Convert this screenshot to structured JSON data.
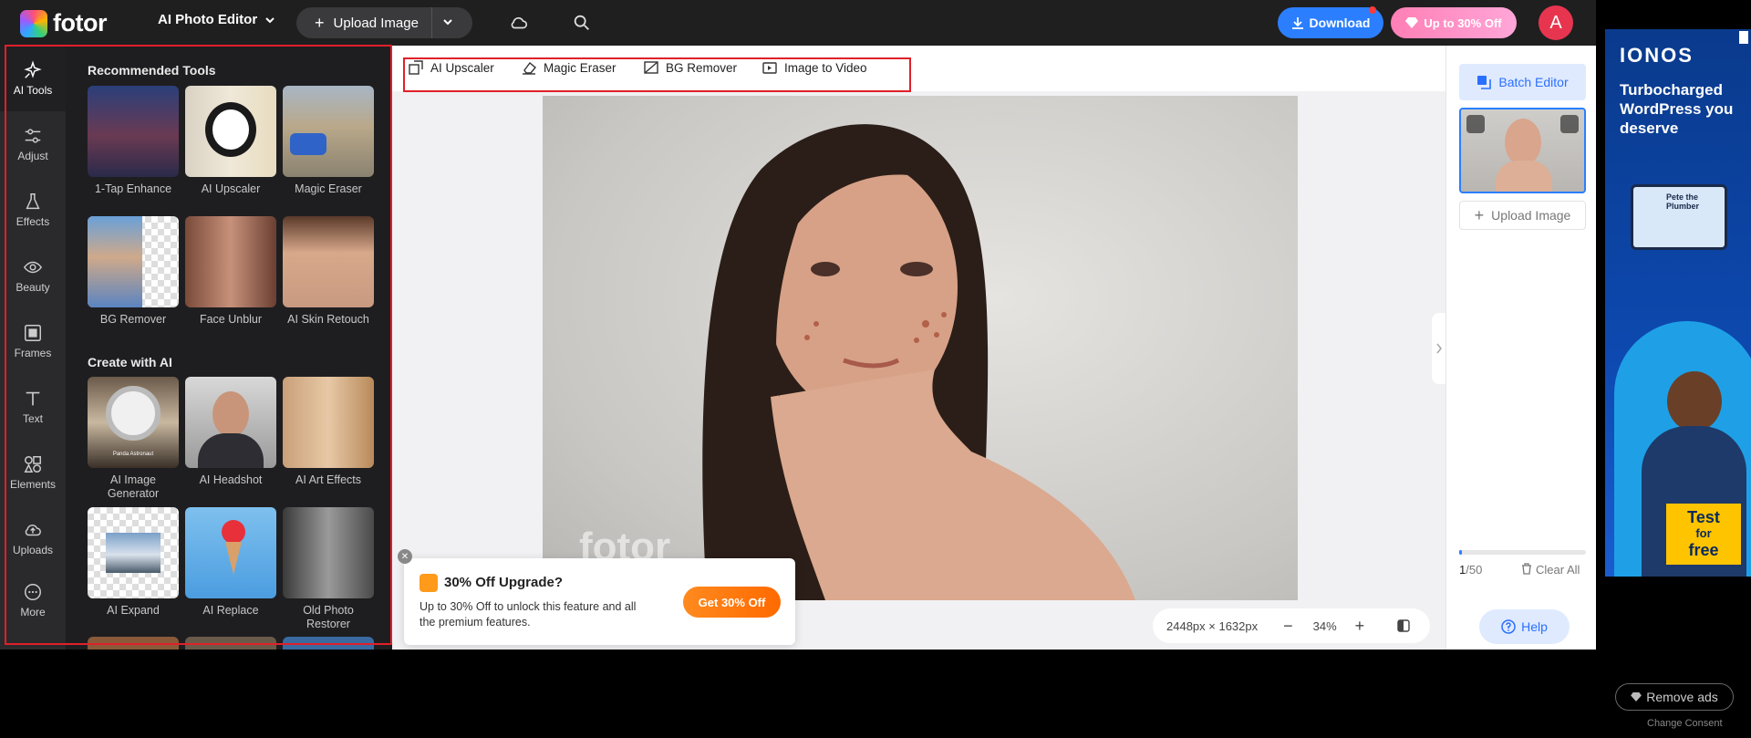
{
  "header": {
    "logo_text": "fotor",
    "editor_menu": "AI Photo Editor",
    "upload_label": "Upload Image",
    "download_label": "Download",
    "promo_label": "Up to 30% Off",
    "avatar_initial": "A"
  },
  "rail": [
    {
      "label": "AI Tools",
      "icon": "sparkles-icon"
    },
    {
      "label": "Adjust",
      "icon": "sliders-icon"
    },
    {
      "label": "Effects",
      "icon": "flask-icon"
    },
    {
      "label": "Beauty",
      "icon": "eye-icon"
    },
    {
      "label": "Frames",
      "icon": "frame-icon"
    },
    {
      "label": "Text",
      "icon": "text-icon"
    },
    {
      "label": "Elements",
      "icon": "shapes-icon"
    },
    {
      "label": "Uploads",
      "icon": "cloud-upload-icon"
    },
    {
      "label": "More",
      "icon": "more-icon"
    }
  ],
  "panel": {
    "recommended_title": "Recommended Tools",
    "recommended": [
      "1-Tap Enhance",
      "AI Upscaler",
      "Magic Eraser",
      "BG Remover",
      "Face Unblur",
      "AI Skin Retouch"
    ],
    "create_title": "Create with AI",
    "create": [
      "AI Image Generator",
      "AI Headshot",
      "AI Art Effects",
      "AI Expand",
      "AI Replace",
      "Old Photo Restorer"
    ],
    "thumb_text": "Panda Astronaut"
  },
  "quickbar": [
    "AI Upscaler",
    "Magic Eraser",
    "BG Remover",
    "Image to Video"
  ],
  "canvas": {
    "watermark": "fotor",
    "dimensions": "2448px × 1632px",
    "zoom": "34%"
  },
  "popup": {
    "title": "30% Off Upgrade?",
    "body": "Up to 30% Off to unlock this feature and all the premium features.",
    "button": "Get 30% Off"
  },
  "sidebar": {
    "batch_label": "Batch Editor",
    "upload_label": "Upload Image",
    "count_current": "1",
    "count_total": "/50",
    "progress": 0.02,
    "clear_label": "Clear All",
    "help_label": "Help"
  },
  "ad": {
    "brand": "IONOS",
    "headline": "Turbocharged WordPress you deserve",
    "screen_text": "Pete the Plumber",
    "cta_line1": "Test",
    "cta_line2": "for",
    "cta_line3": "free"
  },
  "footer": {
    "remove_ads": "Remove ads",
    "change_consent": "Change Consent"
  },
  "colors": {
    "accent": "#2b7fff",
    "highlight": "#e0202a",
    "promo": "#ff8ac4",
    "cta": "#ff7a10"
  }
}
